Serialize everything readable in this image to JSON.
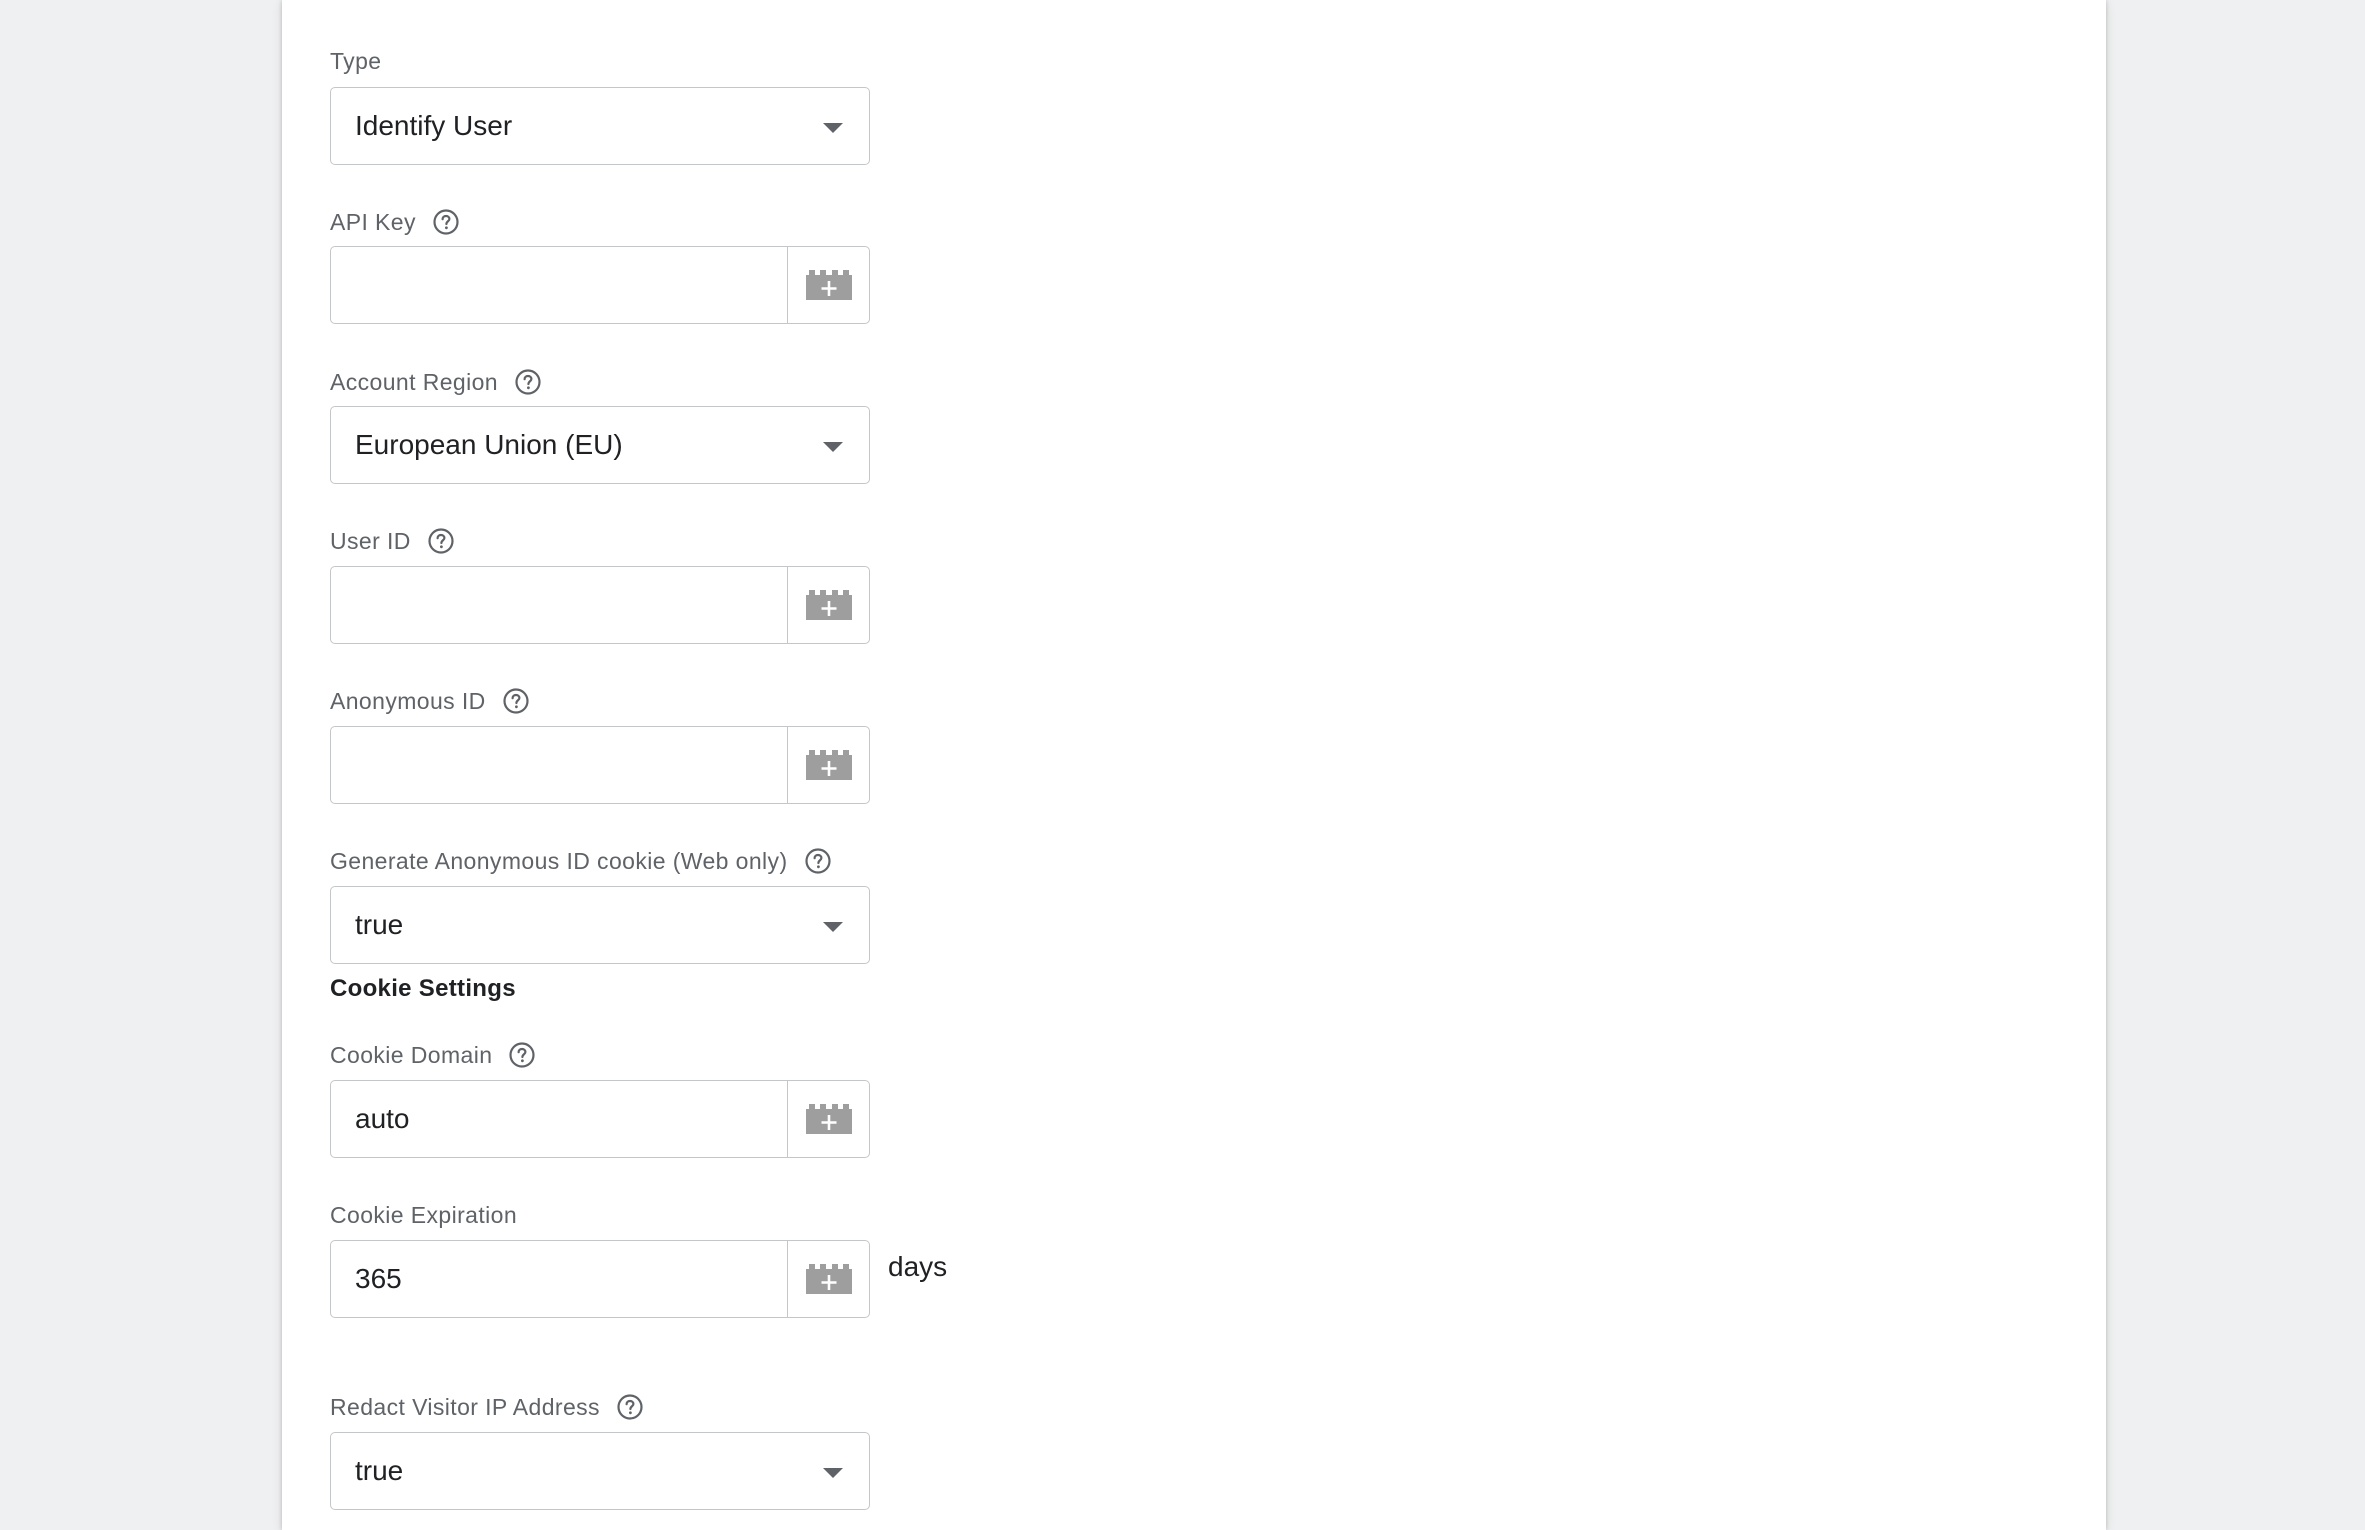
{
  "form": {
    "type": {
      "label": "Type",
      "value": "Identify User"
    },
    "api_key": {
      "label": "API Key",
      "value": ""
    },
    "account_region": {
      "label": "Account Region",
      "value": "European Union (EU)"
    },
    "user_id": {
      "label": "User ID",
      "value": ""
    },
    "anonymous_id": {
      "label": "Anonymous ID",
      "value": ""
    },
    "generate_cookie": {
      "label": "Generate Anonymous ID cookie (Web only)",
      "value": "true"
    },
    "cookie_settings": {
      "title": "Cookie Settings"
    },
    "cookie_domain": {
      "label": "Cookie Domain",
      "value": "auto"
    },
    "cookie_expiration": {
      "label": "Cookie Expiration",
      "value": "365",
      "suffix": "days"
    },
    "redact_ip": {
      "label": "Redact Visitor IP Address",
      "value": "true"
    }
  },
  "icons": {
    "help": "help-circle-icon",
    "variable": "variable-brick-icon",
    "dropdown": "caret-down-icon"
  },
  "colors": {
    "page_background": "#eff0f1",
    "panel_background": "#ffffff",
    "label_text": "#5f6368",
    "value_text": "#202124",
    "border": "#c4c7c9",
    "icon_gray": "#9e9e9e"
  }
}
